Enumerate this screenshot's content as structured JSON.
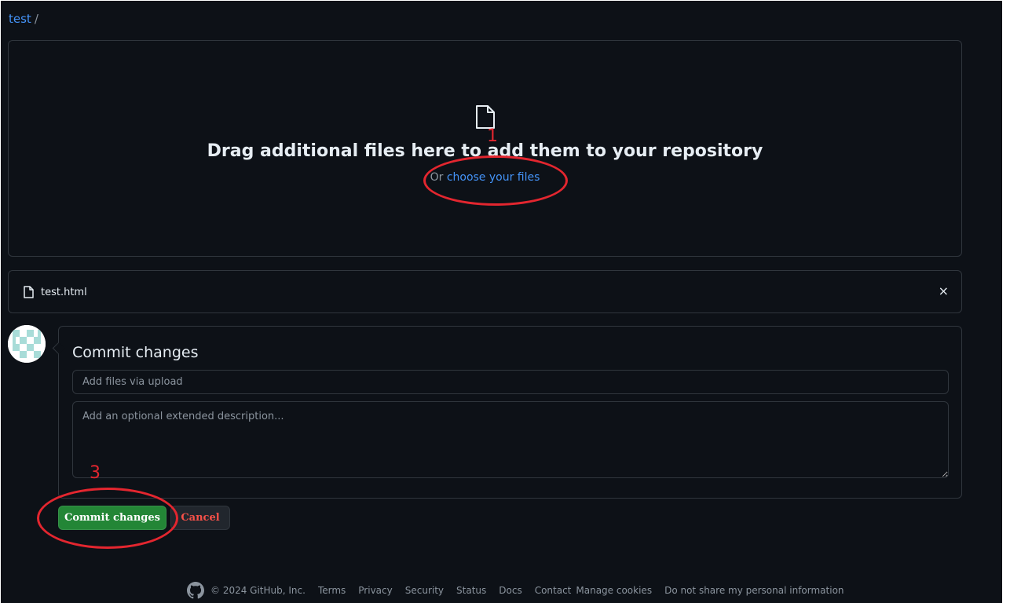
{
  "breadcrumb": {
    "repo": "test",
    "separator": "/"
  },
  "dropzone": {
    "title": "Drag additional files here to add them to your repository",
    "prefix": "Or",
    "link": "choose your files"
  },
  "file": {
    "name": "test.html",
    "remove_icon": "×"
  },
  "commit": {
    "title": "Commit changes",
    "summary_placeholder": "Add files via upload",
    "description_placeholder": "Add an optional extended description..."
  },
  "buttons": {
    "commit": "Commit changes",
    "cancel": "Cancel"
  },
  "annotations": {
    "first": "1",
    "third": "3",
    "color": "#e3262f"
  },
  "footer": {
    "copyright": "© 2024 GitHub, Inc.",
    "links": [
      "Terms",
      "Privacy",
      "Security",
      "Status",
      "Docs",
      "Contact",
      "Manage cookies",
      "Do not share my personal information"
    ]
  },
  "colors": {
    "background": "#0d1117",
    "link": "#4493f8",
    "commit_button": "#238636",
    "cancel_text": "#f85149"
  }
}
